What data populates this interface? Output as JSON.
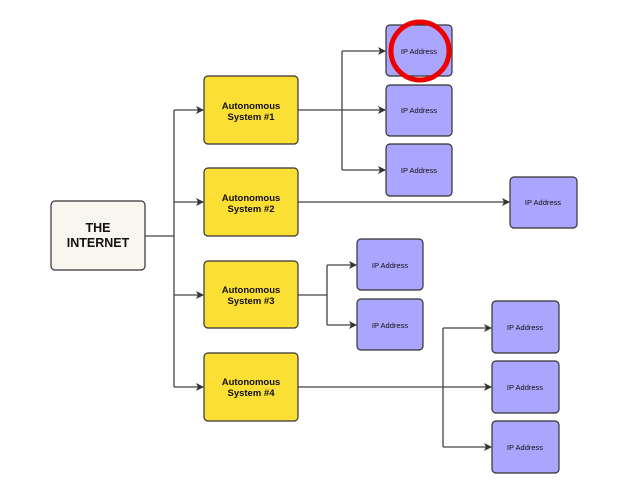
{
  "root": {
    "line1": "THE",
    "line2": "INTERNET"
  },
  "systems": [
    {
      "line1": "Autonomous",
      "line2": "System #1"
    },
    {
      "line1": "Autonomous",
      "line2": "System #2"
    },
    {
      "line1": "Autonomous",
      "line2": "System #3"
    },
    {
      "line1": "Autonomous",
      "line2": "System #4"
    }
  ],
  "ip_label": "IP Address",
  "ip_groups": [
    {
      "system": "System #1",
      "count": 3
    },
    {
      "system": "System #2",
      "count": 1
    },
    {
      "system": "System #3",
      "count": 2
    },
    {
      "system": "System #4",
      "count": 3
    }
  ],
  "highlight": {
    "target": "first IP Address of System #1",
    "shape": "circle",
    "color": "#ee0000"
  },
  "colors": {
    "internet": "#f9f6ef",
    "autonomous_system": "#fcdf35",
    "ip_address": "#aaa5fd",
    "highlight": "#ee0000"
  }
}
